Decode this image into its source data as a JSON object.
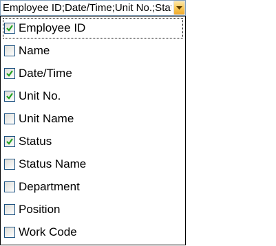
{
  "combo": {
    "value": "Employee ID;Date/Time;Unit No.;Statu",
    "button_icon": "chevron-down-icon"
  },
  "list": {
    "items": [
      {
        "label": "Employee ID",
        "checked": true
      },
      {
        "label": "Name",
        "checked": false
      },
      {
        "label": "Date/Time",
        "checked": true
      },
      {
        "label": "Unit No.",
        "checked": true
      },
      {
        "label": "Unit Name",
        "checked": false
      },
      {
        "label": "Status",
        "checked": true
      },
      {
        "label": "Status Name",
        "checked": false
      },
      {
        "label": "Department",
        "checked": false
      },
      {
        "label": "Position",
        "checked": false
      },
      {
        "label": "Work Code",
        "checked": false
      }
    ]
  },
  "colors": {
    "check": "#21a121",
    "checkbox_border": "#1c5180",
    "combo_border": "#7f9db9",
    "button_accent": "#f0a92b"
  }
}
